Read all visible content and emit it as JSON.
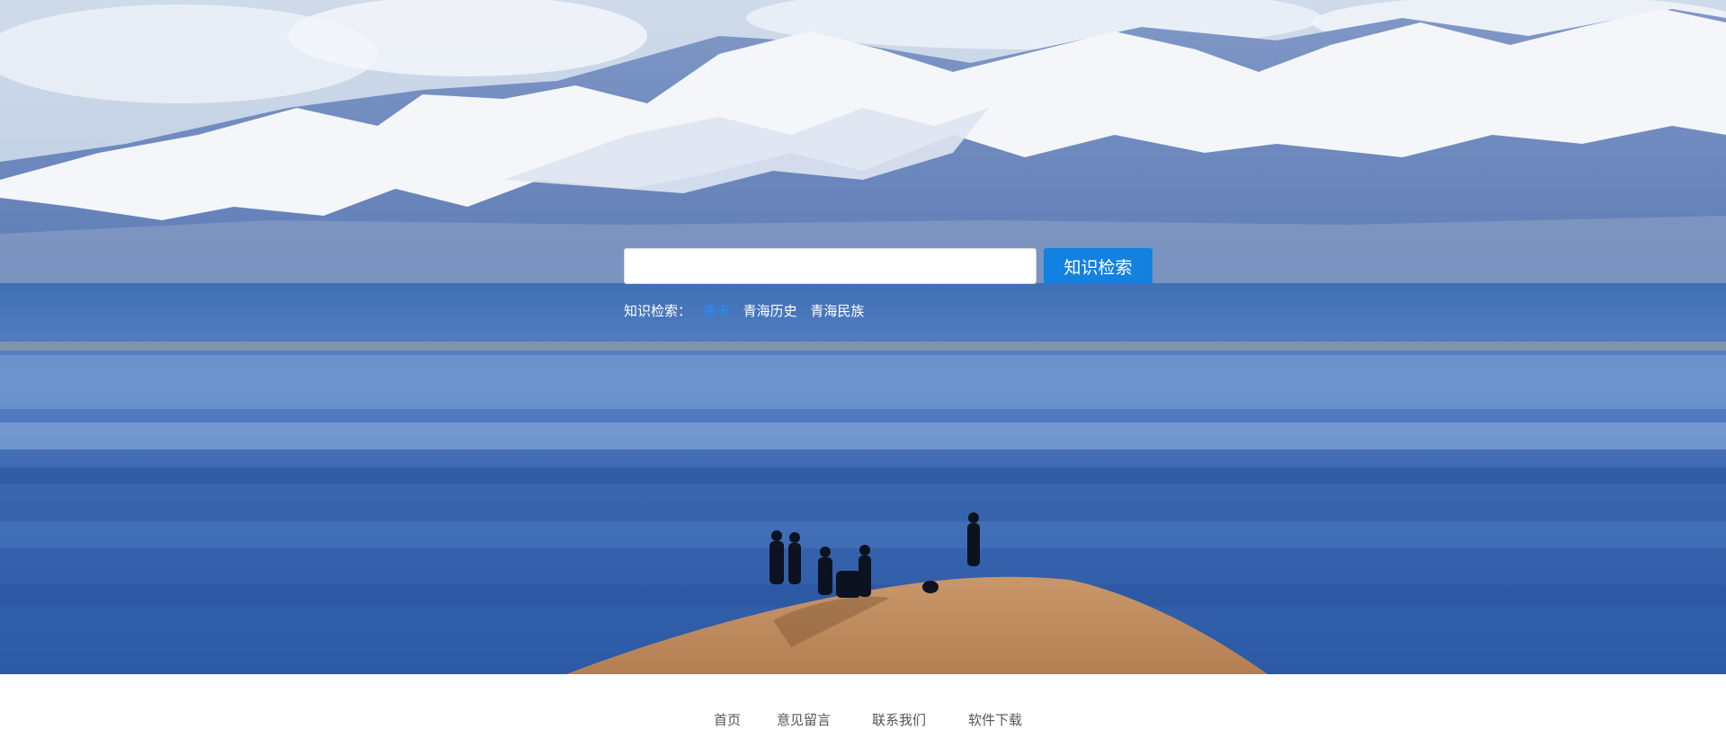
{
  "search": {
    "value": "",
    "placeholder": "",
    "button_label": "知识检索"
  },
  "quick_search": {
    "label": "知识检索：",
    "links": [
      {
        "label": "唐卡",
        "active": true
      },
      {
        "label": "青海历史",
        "active": false
      },
      {
        "label": "青海民族",
        "active": false
      }
    ]
  },
  "footer": {
    "links": [
      {
        "label": "首页"
      },
      {
        "label": "意见留言"
      },
      {
        "label": "联系我们"
      },
      {
        "label": "软件下载"
      }
    ]
  },
  "colors": {
    "accent": "#1381e0",
    "active_link": "#1e8fff",
    "footer_text": "#555555"
  }
}
